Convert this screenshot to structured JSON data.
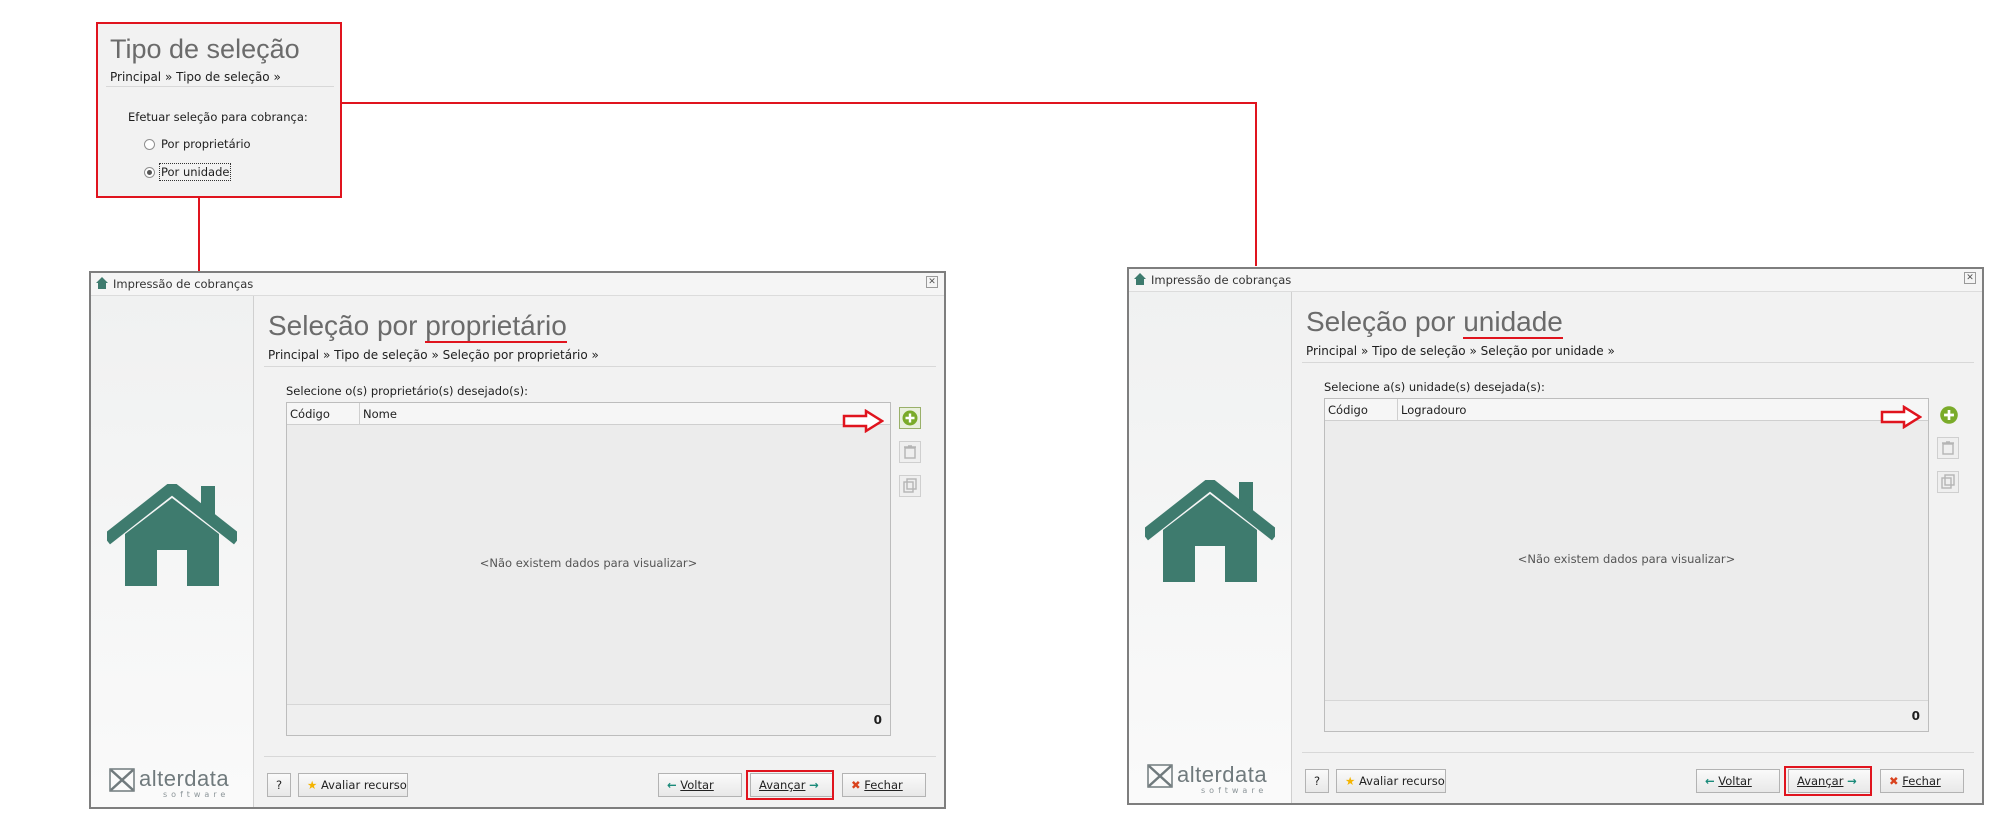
{
  "callout": {
    "title": "Tipo de seleção",
    "breadcrumb": "Principal » Tipo de seleção »",
    "label": "Efetuar seleção para cobrança:",
    "options": [
      {
        "label": "Por proprietário",
        "selected": false
      },
      {
        "label": "Por unidade",
        "selected": true
      }
    ]
  },
  "window_left": {
    "title": "Impressão de cobranças",
    "page_title_prefix": "Seleção por ",
    "page_title_highlight": "proprietário",
    "breadcrumb": "Principal » Tipo de seleção » Seleção por proprietário »",
    "prompt": "Selecione o(s) proprietário(s) desejado(s):",
    "columns": [
      "Código",
      "Nome"
    ],
    "empty_text": "<Não existem dados para visualizar>",
    "count": "0"
  },
  "window_right": {
    "title": "Impressão de cobranças",
    "page_title_prefix": "Seleção por ",
    "page_title_highlight": "unidade",
    "breadcrumb": "Principal » Tipo de seleção » Seleção por unidade »",
    "prompt": "Selecione a(s) unidade(s) desejada(s):",
    "columns": [
      "Código",
      "Logradouro"
    ],
    "empty_text": "<Não existem dados para visualizar>",
    "count": "0"
  },
  "buttons": {
    "help": "?",
    "rate": "Avaliar recurso",
    "back": "Voltar",
    "next": "Avançar",
    "close": "Fechar"
  },
  "logo": {
    "text": "alterdata",
    "sub": "software"
  },
  "colors": {
    "accent_red": "#e0141e",
    "house_green": "#3e7b6e",
    "add_green": "#7aab2a"
  }
}
